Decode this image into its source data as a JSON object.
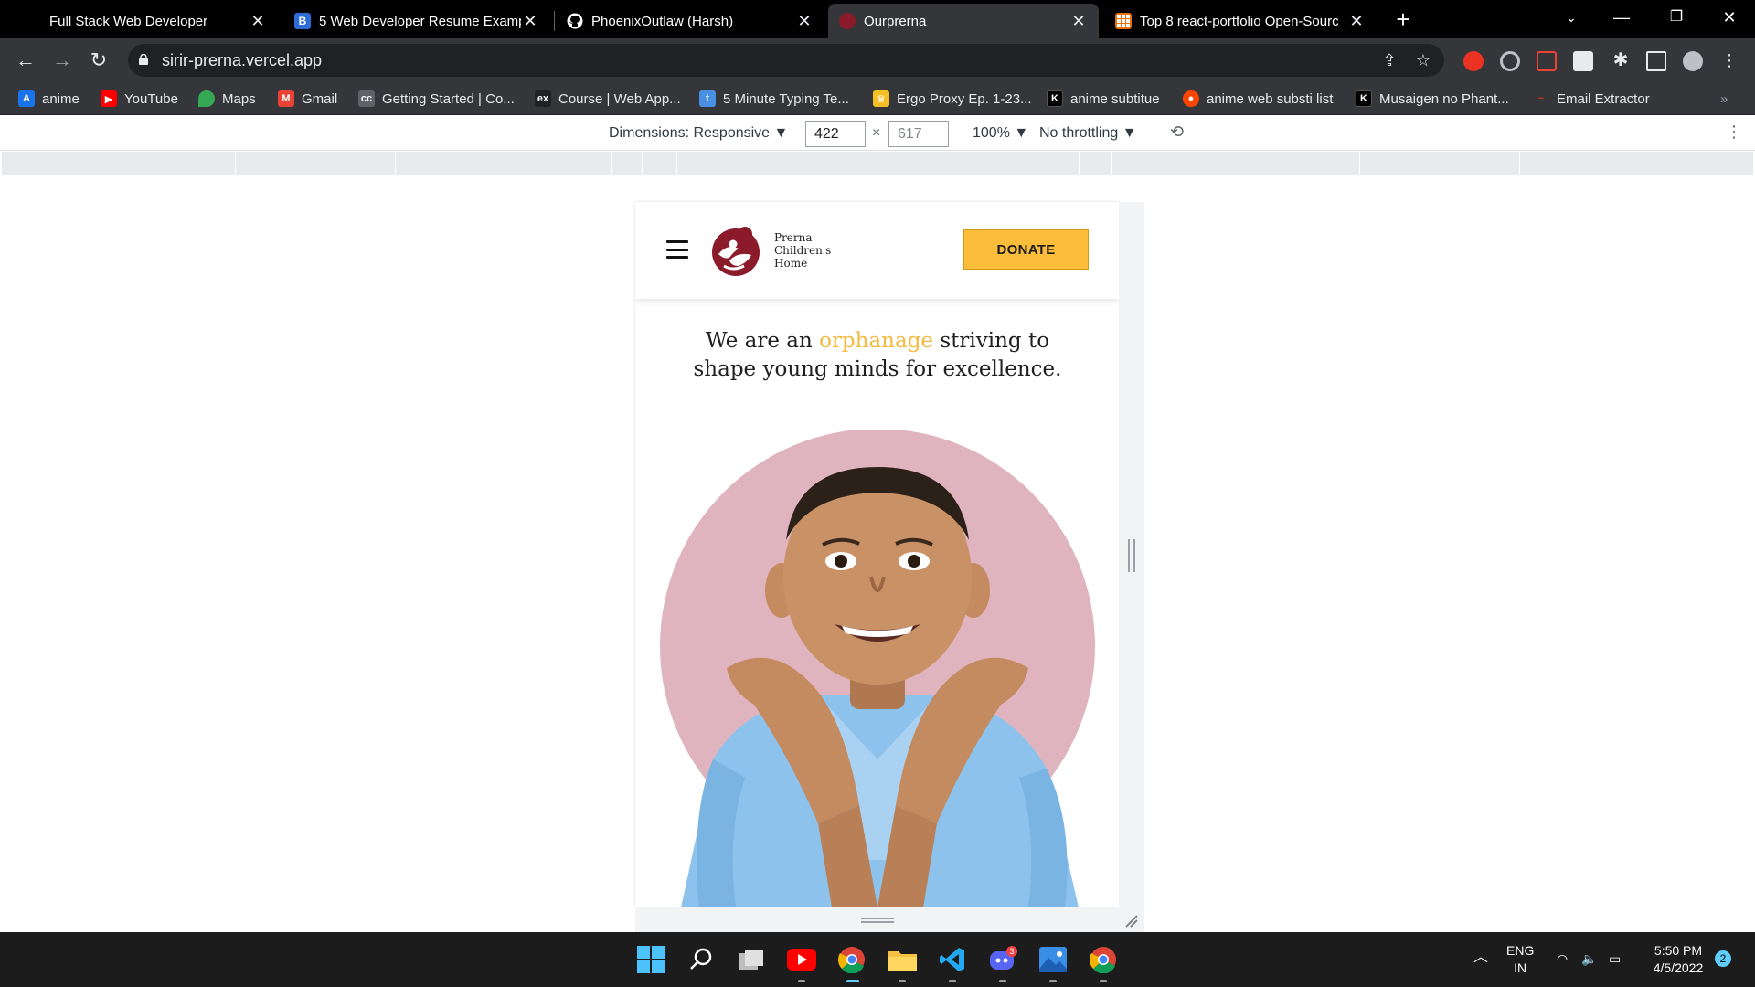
{
  "browser": {
    "tabs": [
      {
        "title": "Full Stack Web Developer",
        "icon": "blank-icon"
      },
      {
        "title": "5 Web Developer Resume Examp",
        "icon": "b-icon"
      },
      {
        "title": "PhoenixOutlaw (Harsh)",
        "icon": "github-icon"
      },
      {
        "title": "Ourprerna",
        "icon": "prerna-icon",
        "active": true
      },
      {
        "title": "Top 8 react-portfolio Open-Sourc",
        "icon": "grid-icon"
      }
    ],
    "url": "sirir-prerna.vercel.app",
    "bookmarks": [
      {
        "label": "anime",
        "color": "#1a73e8"
      },
      {
        "label": "YouTube",
        "color": "#ff0000"
      },
      {
        "label": "Maps",
        "color": "#34a853"
      },
      {
        "label": "Gmail",
        "color": "#ea4335"
      },
      {
        "label": "Getting Started | Co...",
        "color": "#5f6368"
      },
      {
        "label": "Course | Web App...",
        "color": "#202124"
      },
      {
        "label": "5 Minute Typing Te...",
        "color": "#4a90e2"
      },
      {
        "label": "Ergo Proxy Ep. 1-23...",
        "color": "#f6bf26"
      },
      {
        "label": "anime subtitue",
        "color": "#000000"
      },
      {
        "label": "anime web substi list",
        "color": "#ff4500"
      },
      {
        "label": "Musaigen no Phant...",
        "color": "#000000"
      },
      {
        "label": "Email Extractor",
        "color": "#d93025"
      }
    ]
  },
  "devtools": {
    "dimensions_label": "Dimensions: Responsive",
    "width": "422",
    "height": "617",
    "zoom": "100%",
    "throttling": "No throttling"
  },
  "site": {
    "brand_line1": "Prerna",
    "brand_line2": "Children's",
    "brand_line3": "Home",
    "donate_label": "DONATE",
    "hero_pre": "We are an ",
    "hero_highlight": "orphanage",
    "hero_post": " striving to shape young minds for excellence.",
    "accent_color": "#f5b93f",
    "brand_color": "#8b1a2b",
    "circle_color": "#e0b4bf"
  },
  "taskbar": {
    "lang_line1": "ENG",
    "lang_line2": "IN",
    "time": "5:50 PM",
    "date": "4/5/2022",
    "notifications": "2",
    "discord_badge": "3"
  }
}
